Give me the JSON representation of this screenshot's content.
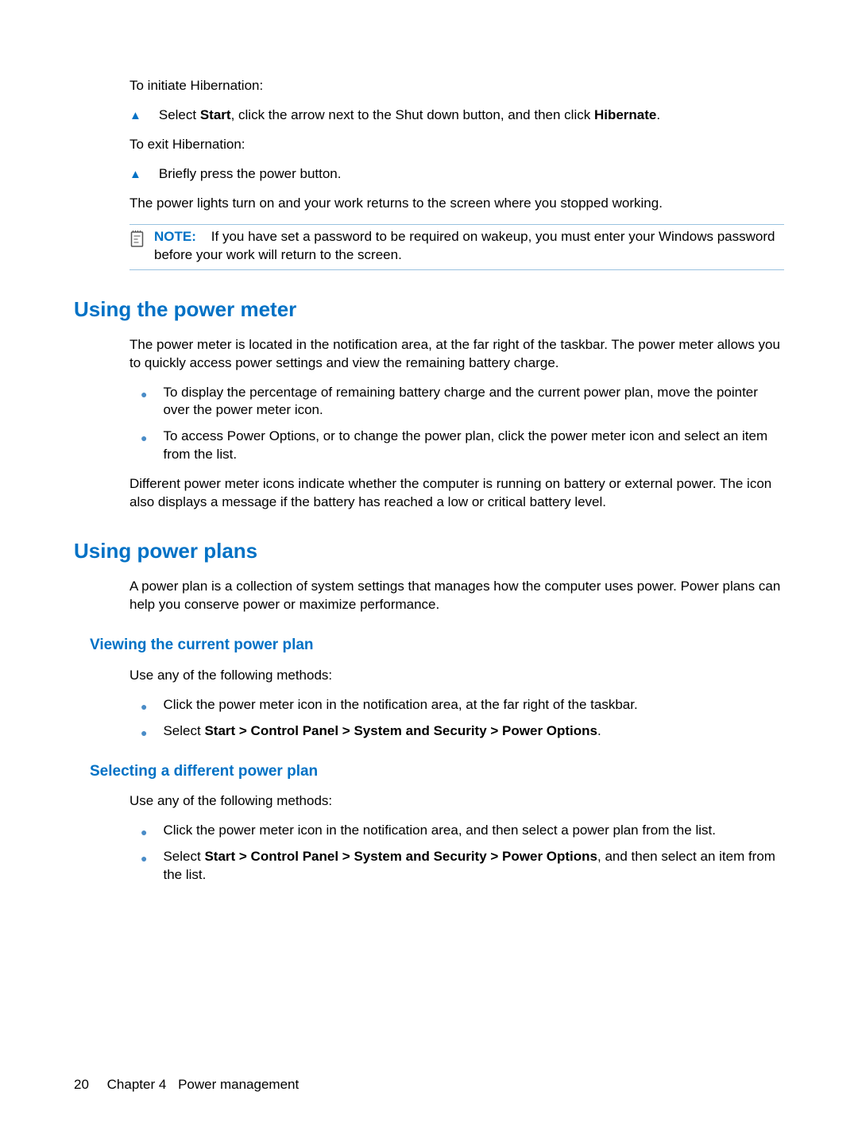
{
  "section_hibernation": {
    "initiate_label": "To initiate Hibernation:",
    "step1_prefix": "Select ",
    "step1_bold1": "Start",
    "step1_mid": ", click the arrow next to the Shut down button, and then click ",
    "step1_bold2": "Hibernate",
    "step1_suffix": ".",
    "exit_label": "To exit Hibernation:",
    "step2_text": "Briefly press the power button.",
    "return_text": "The power lights turn on and your work returns to the screen where you stopped working.",
    "note_label": "NOTE:",
    "note_text": "If you have set a password to be required on wakeup, you must enter your Windows password before your work will return to the screen."
  },
  "section_power_meter": {
    "heading": "Using the power meter",
    "intro": "The power meter is located in the notification area, at the far right of the taskbar. The power meter allows you to quickly access power settings and view the remaining battery charge.",
    "bullet1": "To display the percentage of remaining battery charge and the current power plan, move the pointer over the power meter icon.",
    "bullet2": "To access Power Options, or to change the power plan, click the power meter icon and select an item from the list.",
    "outro": "Different power meter icons indicate whether the computer is running on battery or external power. The icon also displays a message if the battery has reached a low or critical battery level."
  },
  "section_power_plans": {
    "heading": "Using power plans",
    "intro": "A power plan is a collection of system settings that manages how the computer uses power. Power plans can help you conserve power or maximize performance.",
    "sub1_heading": "Viewing the current power plan",
    "sub1_intro": "Use any of the following methods:",
    "sub1_bullet1": "Click the power meter icon in the notification area, at the far right of the taskbar.",
    "sub1_bullet2_prefix": "Select ",
    "sub1_bullet2_bold": "Start > Control Panel > System and Security > Power Options",
    "sub1_bullet2_suffix": ".",
    "sub2_heading": "Selecting a different power plan",
    "sub2_intro": "Use any of the following methods:",
    "sub2_bullet1": "Click the power meter icon in the notification area, and then select a power plan from the list.",
    "sub2_bullet2_prefix": "Select ",
    "sub2_bullet2_bold": "Start > Control Panel > System and Security > Power Options",
    "sub2_bullet2_suffix": ", and then select an item from the list."
  },
  "footer": {
    "page_number": "20",
    "chapter_label": "Chapter 4",
    "chapter_title": "Power management"
  }
}
